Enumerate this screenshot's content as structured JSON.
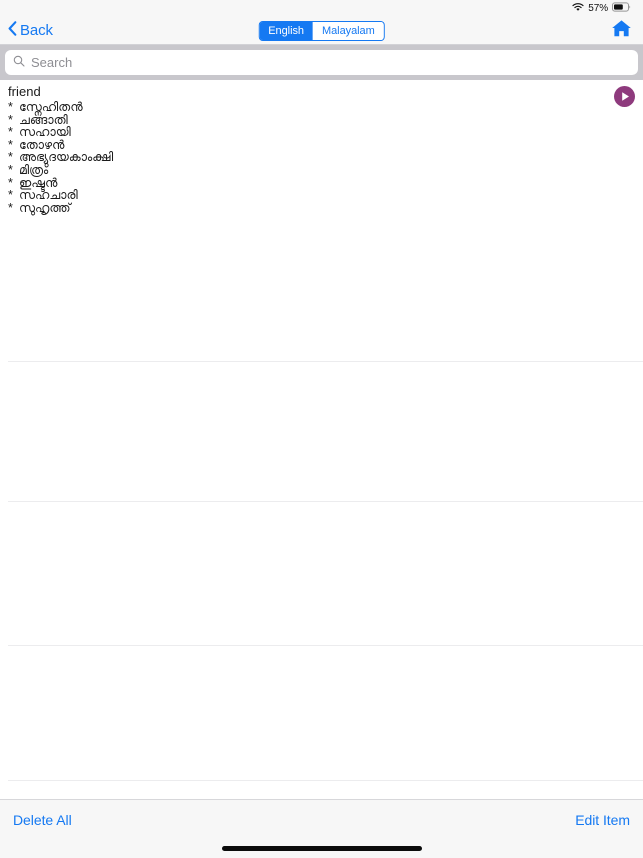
{
  "status_bar": {
    "wifi_icon": "wifi-icon",
    "battery_percent": "57%",
    "battery_icon": "battery-icon"
  },
  "nav_bar": {
    "back_icon": "chevron-left-icon",
    "back_label": "Back",
    "home_icon": "home-icon",
    "language_toggle": {
      "options": [
        "English",
        "Malayalam"
      ],
      "selected": "English",
      "english_label": "English",
      "malayalam_label": "Malayalam"
    }
  },
  "search": {
    "icon": "search-icon",
    "placeholder": "Search",
    "value": ""
  },
  "entry": {
    "headword": "friend",
    "play_icon": "play-circle-icon",
    "bullet": "*",
    "senses": [
      "സ്നേഹിതൻ",
      "ചങ്ങാതി",
      "സഹായി",
      "തോഴൻ",
      "അഭ്യുദയകാംക്ഷി",
      "മിത്രം",
      "ഇഷ്ടൻ",
      "സഹചാരി",
      "സുഹൃത്ത്"
    ]
  },
  "toolbar": {
    "delete_all_label": "Delete All",
    "edit_item_label": "Edit Item"
  },
  "colors": {
    "accent_blue": "#1579f2",
    "play_purple": "#8e3a7d",
    "search_band": "#c8c7cc",
    "chrome_gray": "#f7f7f7",
    "rule_gray": "#ececee"
  }
}
